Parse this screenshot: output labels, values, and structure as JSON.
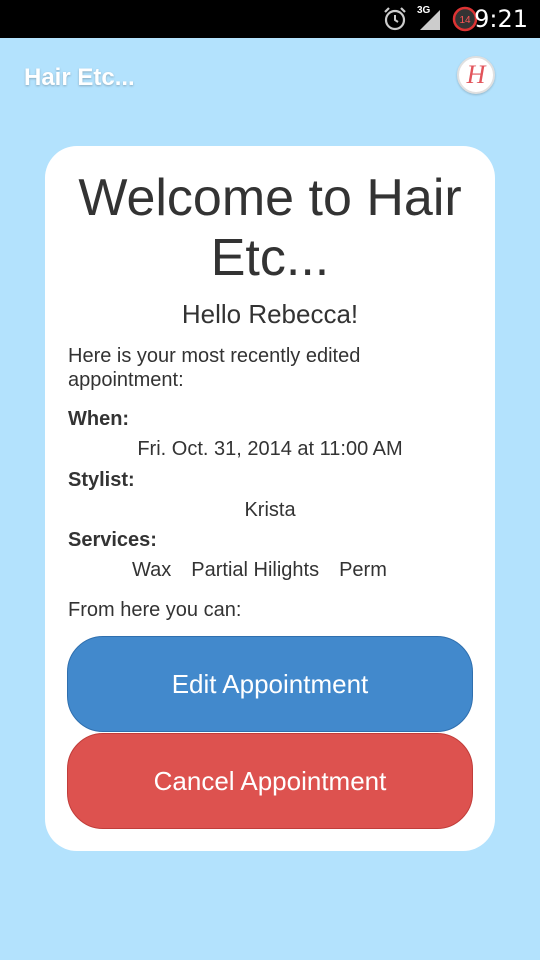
{
  "status_bar": {
    "time": "9:21",
    "network": "3G",
    "battery_level": "14",
    "icons": [
      "alarm-icon",
      "signal-icon",
      "battery-icon"
    ]
  },
  "app_bar": {
    "title": "Hair Etc...",
    "logo_letter": "H"
  },
  "card": {
    "welcome": "Welcome to Hair Etc...",
    "greeting": "Hello Rebecca!",
    "intro": "Here is your most recently edited appointment:",
    "when_label": "When:",
    "when_value": "Fri. Oct. 31, 2014 at 11:00 AM",
    "stylist_label": "Stylist:",
    "stylist_value": "Krista",
    "services_label": "Services:",
    "services": [
      "Wax",
      "Partial Hilights",
      "Perm"
    ],
    "from_here": "From here you can:",
    "edit_button": "Edit Appointment",
    "cancel_button": "Cancel Appointment"
  },
  "colors": {
    "background": "#b3e2fd",
    "edit_button": "#4289cc",
    "cancel_button": "#dd524f"
  }
}
